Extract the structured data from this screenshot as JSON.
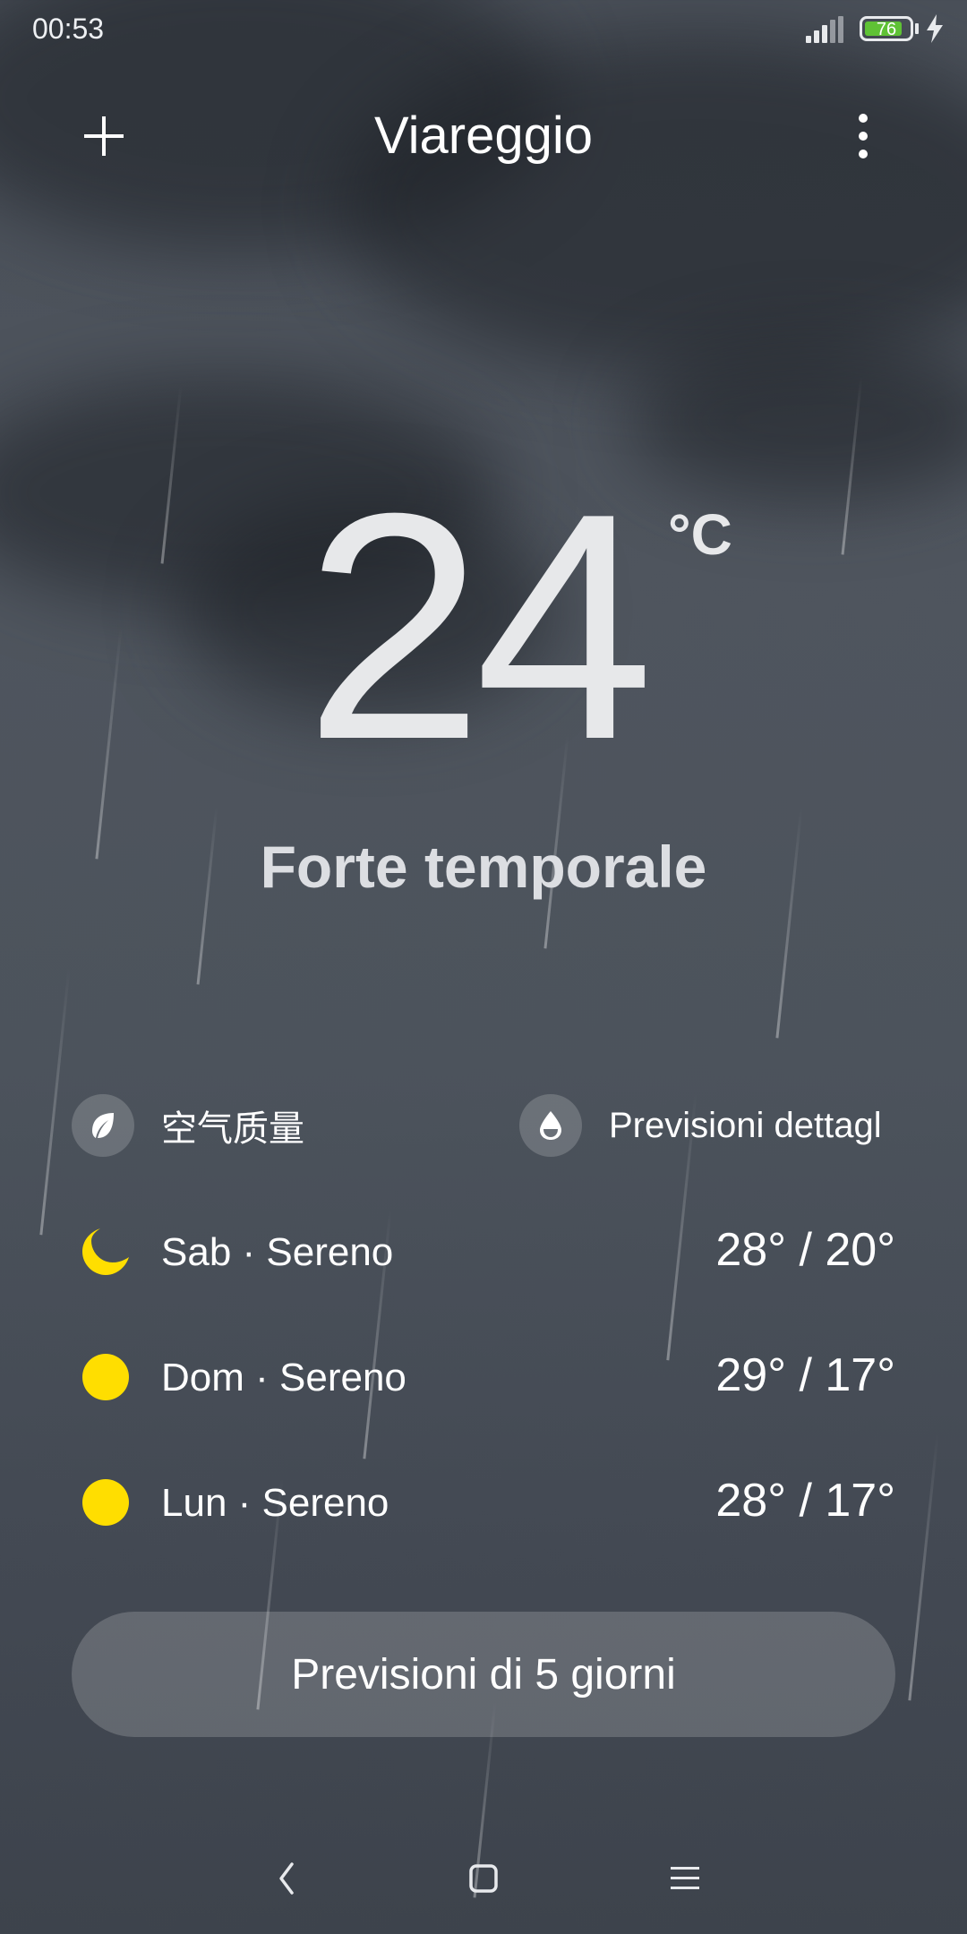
{
  "status_bar": {
    "time": "00:53",
    "battery_level": "76",
    "battery_color": "#5fc235",
    "icons": [
      "signal-icon",
      "battery-icon",
      "charging-bolt-icon"
    ]
  },
  "header": {
    "city": "Viareggio",
    "add_icon": "plus-icon",
    "menu_icon": "more-vertical-icon"
  },
  "current": {
    "temperature": "24",
    "unit": "°C",
    "condition": "Forte temporale"
  },
  "info": {
    "air_quality_label": "空气质量",
    "air_quality_icon": "leaf-icon",
    "detailed_forecast_label": "Previsioni dettagl",
    "detailed_forecast_icon": "water-drop-icon"
  },
  "forecast": [
    {
      "label": "Sab · Sereno",
      "temps": "28° / 20°",
      "icon": "moon-icon"
    },
    {
      "label": "Dom · Sereno",
      "temps": "29° / 17°",
      "icon": "sun-icon"
    },
    {
      "label": "Lun · Sereno",
      "temps": "28° / 17°",
      "icon": "sun-icon"
    }
  ],
  "accent_yellow": "#ffde00",
  "five_day_button": "Previsioni di 5 giorni",
  "nav": [
    "back-icon",
    "home-icon",
    "recents-icon"
  ]
}
